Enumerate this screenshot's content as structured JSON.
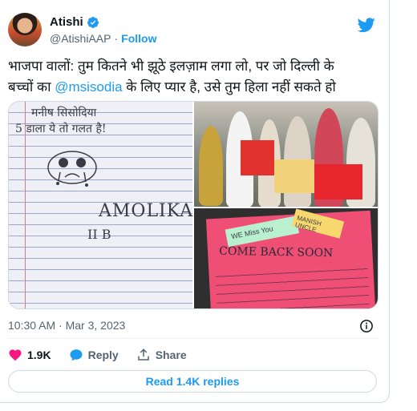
{
  "author": {
    "name": "Atishi",
    "handle": "@AtishiAAP",
    "separator": "·",
    "follow_label": "Follow"
  },
  "tweet": {
    "line1": "भाजपा वालों: तुम कितने भी झूठे इलज़ाम लगा लो, पर जो दिल्ली के",
    "line2_pre": "बच्चों का ",
    "mention": "@msisodia",
    "line2_post": " के लिए प्यार है, उसे तुम हिला नहीं सकते हो"
  },
  "media": {
    "note_line1": "मनीष सिसोदिया",
    "note_line2": "5 डाला ये तो गलत है!",
    "note_name": "AMOLIKA",
    "note_class": "II B",
    "card_text1": "WE Miss You",
    "card_text2": "MANISH UNCLE",
    "card_text3": "COME BACK SOON"
  },
  "timestamp": "10:30 AM · Mar 3, 2023",
  "actions": {
    "likes": "1.9K",
    "reply_label": "Reply",
    "share_label": "Share"
  },
  "read_replies_label": "Read 1.4K replies",
  "colors": {
    "accent": "#1d9bf0",
    "like": "#f91880",
    "text": "#0f1419",
    "muted": "#536471"
  },
  "icons": [
    "verified-badge-icon",
    "twitter-bird-icon",
    "info-icon",
    "heart-icon",
    "reply-icon",
    "share-icon"
  ]
}
